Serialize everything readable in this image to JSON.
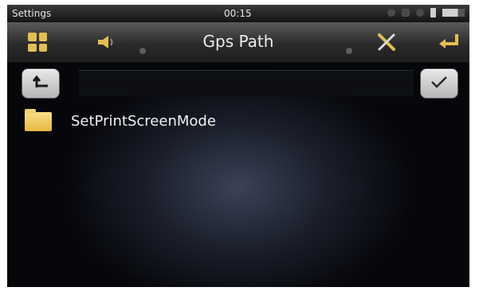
{
  "status": {
    "title": "Settings",
    "time": "00:15"
  },
  "toolbar": {
    "title": "Gps Path",
    "icons": [
      "apps-grid-icon",
      "speaker-icon",
      "tools-icon",
      "enter-icon"
    ]
  },
  "nav": {
    "up_icon": "up-arrow-icon",
    "confirm_icon": "checkmark-icon"
  },
  "files": [
    {
      "name": "SetPrintScreenMode",
      "icon": "folder-icon"
    }
  ],
  "colors": {
    "accent": "#e2bf52",
    "background": "#06070b"
  }
}
